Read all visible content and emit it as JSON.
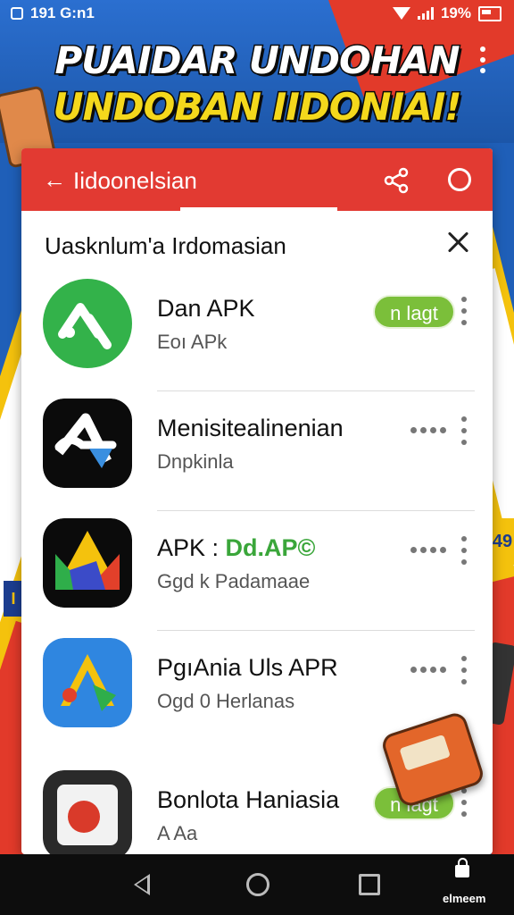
{
  "status_bar": {
    "time": "191 G:n1",
    "battery": "19%"
  },
  "headline": {
    "line1": "PUAIDAR UNDOHAN",
    "line2": "UNDOBAN IIDONIAI!"
  },
  "app_bar": {
    "back_arrow": "←",
    "title": "Iidoonelsian"
  },
  "section": {
    "title": "Uasknlum'a Irdomasian"
  },
  "apps": [
    {
      "name": "Dan APK",
      "name_highlight": "",
      "subtitle": "Eoı APk",
      "action": "n lagt",
      "icon": "green-a-logo"
    },
    {
      "name": "Menisitealinenian",
      "name_highlight": "",
      "subtitle": "Dnpkinla",
      "action": "",
      "icon": "black-a-logo"
    },
    {
      "name": "APK : ",
      "name_highlight": "Dd.AP©",
      "subtitle": "Ggd k Padamaae",
      "action": "",
      "icon": "triangle-logo"
    },
    {
      "name": "PgıAnia Uls APR",
      "name_highlight": "",
      "subtitle": "Ogd 0 Herlanas",
      "action": "",
      "icon": "blue-a-logo"
    },
    {
      "name": "Bonlota Haniasia",
      "name_highlight": "",
      "subtitle": "A Aa",
      "action": "n lagt",
      "icon": "red-shield-logo"
    }
  ],
  "nav_bar": {
    "label": "elmeem"
  },
  "colors": {
    "app_bar": "#e23a32",
    "install_button": "#7bbf3a",
    "headline_yellow": "#f4d81c"
  }
}
